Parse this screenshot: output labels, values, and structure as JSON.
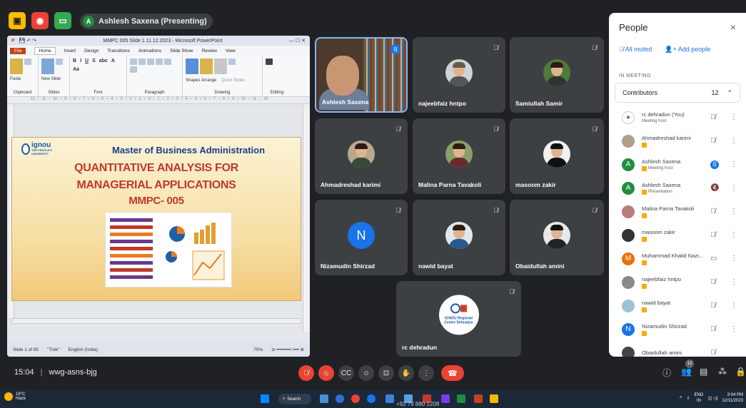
{
  "meet": {
    "presenting_label": "Ashlesh Saxena (Presenting)",
    "presenting_initial": "A",
    "time": "15:04",
    "separator": "|",
    "meeting_code": "wwg-asns-bjg",
    "people_count": "12"
  },
  "ppt": {
    "title": "MMPC 005 Slide 1 11.12.2023 - Microsoft PowerPoint",
    "tabs": [
      "File",
      "Home",
      "Insert",
      "Design",
      "Transitions",
      "Animations",
      "Slide Show",
      "Review",
      "View"
    ],
    "groups": [
      "Clipboard",
      "Slides",
      "Font",
      "Paragraph",
      "Drawing",
      "Editing"
    ],
    "ribbon_labels": {
      "paste": "Paste",
      "new_slide": "New Slide",
      "shapes": "Shapes",
      "arrange": "Arrange",
      "quick_styles": "Quick Styles",
      "editing": "Editing"
    },
    "ruler": "· 12 · ı · 11 · ı · 10 · ı · 9 · ı · 8 · ı · 7 · ı · 6 · ı · 5 · ı · 4 · ı · 3 · ı · 2 · ı · 1 · ı · 0 · ı · 1 · ı · 2 · ı · 3 · ı · 4 · ı · 5 · ı · 6 · ı · 7 · ı · 8 · ı · 9 · ı · 10 · ı · 11 · ı · 12 ·",
    "status_slide": "Slide 1 of 85",
    "status_theme": "\"Trek\"",
    "status_lang": "English (India)",
    "zoom": "70%",
    "slide": {
      "logo_text": "ignou",
      "logo_sub": "THE PEOPLE'S UNIVERSITY",
      "heading": "Master of Business Administration",
      "line1": "QUANTITATIVE ANALYSIS FOR",
      "line2": "MANAGERIAL APPLICATIONS",
      "line3": "MMPC- 005"
    }
  },
  "tiles": [
    {
      "name": "Ashlesh Saxena"
    },
    {
      "name": "najeebfaiz hntpo"
    },
    {
      "name": "Samiullah Samir"
    },
    {
      "name": "Ahmadreshad karimi"
    },
    {
      "name": "Malina Parna Tavakoli"
    },
    {
      "name": "masoom zakir"
    },
    {
      "name": "Nizamudin Shirzad",
      "initial": "N"
    },
    {
      "name": "nawid bayat"
    },
    {
      "name": "Obaidullah amini"
    },
    {
      "name": "rc dehradun",
      "logo_text": "IGNOU Regional Centre Dehradun"
    }
  ],
  "panel": {
    "title": "People",
    "close": "×",
    "all_muted": "All muted",
    "add_people": "Add people",
    "in_meeting": "IN MEETING",
    "contributors": "Contributors",
    "contributors_count": "12",
    "people": [
      {
        "name": "rc dehradun (You)",
        "role": "Meeting host"
      },
      {
        "name": "Ahmadreshad karimi",
        "role": ""
      },
      {
        "name": "Ashlesh Saxena",
        "role": "Meeting host",
        "initial": "A"
      },
      {
        "name": "Ashlesh Saxena",
        "role": "Presentation",
        "initial": "A"
      },
      {
        "name": "Malina Parna Tavakoli",
        "role": ""
      },
      {
        "name": "masoom zakir",
        "role": ""
      },
      {
        "name": "Muhammad Khalid Nazi...",
        "role": "",
        "initial": "M"
      },
      {
        "name": "najeebfaiz hntpo",
        "role": ""
      },
      {
        "name": "nawid bayat",
        "role": ""
      },
      {
        "name": "Nizamudin Shirzad",
        "role": "",
        "initial": "N"
      },
      {
        "name": "Obaidullah amini",
        "role": ""
      }
    ]
  },
  "taskbar": {
    "temp": "19°C",
    "weather": "Haze",
    "search": "Search",
    "phone": "+92 79 880 1208",
    "lang1": "ENG",
    "lang2": "IN",
    "time": "3:04 PM",
    "date": "12/11/2023"
  },
  "colors": {
    "accent": "#1a73e8",
    "end_call": "#ea4335",
    "panel_bg": "#ffffff",
    "meet_bg": "#202124"
  }
}
